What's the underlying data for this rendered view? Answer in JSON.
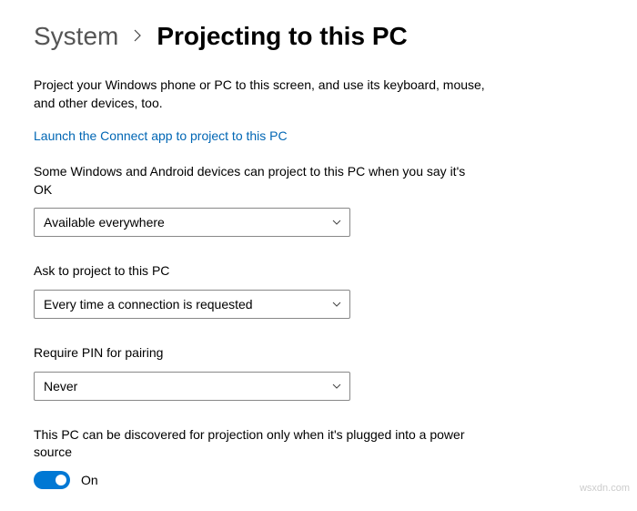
{
  "breadcrumb": {
    "parent": "System",
    "current": "Projecting to this PC"
  },
  "description": "Project your Windows phone or PC to this screen, and use its keyboard, mouse, and other devices, too.",
  "launch_link": "Launch the Connect app to project to this PC",
  "fields": {
    "availability": {
      "label": "Some Windows and Android devices can project to this PC when you say it's OK",
      "value": "Available everywhere"
    },
    "ask": {
      "label": "Ask to project to this PC",
      "value": "Every time a connection is requested"
    },
    "pin": {
      "label": "Require PIN for pairing",
      "value": "Never"
    }
  },
  "discovery": {
    "label": "This PC can be discovered for projection only when it's plugged into a power source",
    "state_label": "On"
  },
  "watermark": "wsxdn.com"
}
